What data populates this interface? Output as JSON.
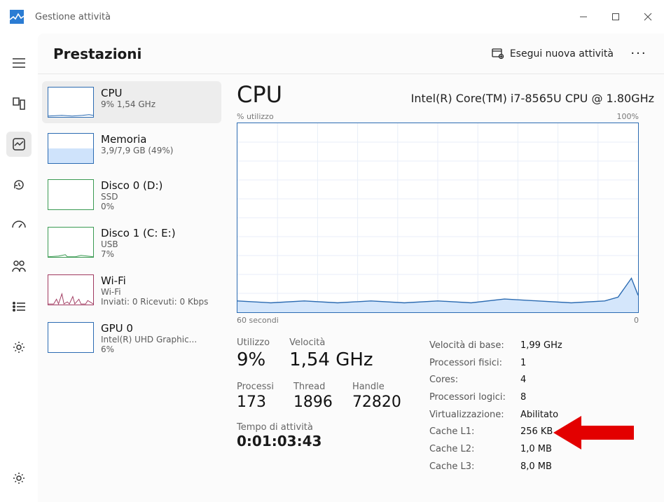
{
  "app": {
    "title": "Gestione attività"
  },
  "header": {
    "title": "Prestazioni",
    "new_task": "Esegui nuova attività"
  },
  "sidelist": {
    "cpu": {
      "title": "CPU",
      "sub": "9%  1,54 GHz"
    },
    "mem": {
      "title": "Memoria",
      "sub": "3,9/7,9 GB (49%)"
    },
    "disk0": {
      "title": "Disco 0 (D:)",
      "sub1": "SSD",
      "sub2": "0%"
    },
    "disk1": {
      "title": "Disco 1 (C: E:)",
      "sub1": "USB",
      "sub2": "7%"
    },
    "wifi": {
      "title": "Wi-Fi",
      "sub1": "Wi-Fi",
      "sub2": "Inviati: 0 Ricevuti: 0 Kbps"
    },
    "gpu": {
      "title": "GPU 0",
      "sub1": "Intel(R) UHD Graphic...",
      "sub2": "6%"
    }
  },
  "detail": {
    "title": "CPU",
    "model": "Intel(R) Core(TM) i7-8565U CPU @ 1.80GHz",
    "util_label": "% utilizzo",
    "util_max": "100%",
    "x_left": "60 secondi",
    "x_right": "0",
    "stats": {
      "util_label": "Utilizzo",
      "util_value": "9%",
      "speed_label": "Velocità",
      "speed_value": "1,54 GHz",
      "proc_label": "Processi",
      "proc_value": "173",
      "thread_label": "Thread",
      "thread_value": "1896",
      "handle_label": "Handle",
      "handle_value": "72820",
      "uptime_label": "Tempo di attività",
      "uptime_value": "0:01:03:43"
    },
    "specs": {
      "base_speed_k": "Velocità di base:",
      "base_speed_v": "1,99 GHz",
      "sockets_k": "Processori fisici:",
      "sockets_v": "1",
      "cores_k": "Cores:",
      "cores_v": "4",
      "logical_k": "Processori logici:",
      "logical_v": "8",
      "virt_k": "Virtualizzazione:",
      "virt_v": "Abilitato",
      "l1_k": "Cache L1:",
      "l1_v": "256 KB",
      "l2_k": "Cache L2:",
      "l2_v": "1,0 MB",
      "l3_k": "Cache L3:",
      "l3_v": "8,0 MB"
    }
  },
  "chart_data": {
    "type": "area",
    "title": "CPU % utilizzo",
    "xlabel": "secondi",
    "ylabel": "% utilizzo",
    "xlim": [
      60,
      0
    ],
    "ylim": [
      0,
      100
    ],
    "x": [
      60,
      55,
      50,
      45,
      40,
      35,
      30,
      25,
      20,
      15,
      10,
      5,
      3,
      1,
      0
    ],
    "values": [
      6,
      5,
      6,
      5,
      6,
      5,
      6,
      5,
      7,
      6,
      5,
      6,
      8,
      18,
      9
    ]
  }
}
